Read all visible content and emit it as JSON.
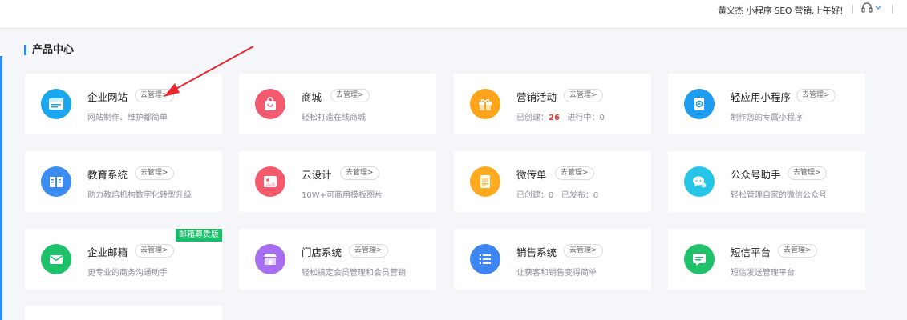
{
  "header": {
    "user_text": "黄义杰  小程序  SEO  营销,上午好!"
  },
  "section": {
    "title": "产品中心"
  },
  "manage_label": "去管理>",
  "cards": [
    {
      "name": "企业网站",
      "desc": "网站制作、维护都简单",
      "icon": "website-icon",
      "color": "#1aa7ee"
    },
    {
      "name": "商城",
      "desc": "轻松打造在线商城",
      "icon": "shopping-bag-icon",
      "color": "#f25a6f"
    },
    {
      "name": "营销活动",
      "desc_prefix": "已创建：",
      "desc_count": "26",
      "desc_suffix": "进行中：0",
      "icon": "gift-icon",
      "color": "#ffa41b"
    },
    {
      "name": "轻应用小程序",
      "desc": "制作您的专属小程序",
      "icon": "mini-program-icon",
      "color": "#1e9cf0"
    },
    {
      "name": "教育系统",
      "desc": "助力教培机构数字化转型升级",
      "icon": "book-icon",
      "color": "#3d8cf2"
    },
    {
      "name": "云设计",
      "desc": "10W+可商用模板图片",
      "icon": "image-icon",
      "color": "#f35a6b"
    },
    {
      "name": "微传单",
      "desc": "已创建：0   已发布：0",
      "icon": "flyer-icon",
      "color": "#ffaa1f"
    },
    {
      "name": "公众号助手",
      "desc": "轻松管理自家的微信公众号",
      "icon": "wechat-icon",
      "color": "#26c4e6"
    },
    {
      "name": "企业邮箱",
      "desc": "更专业的商务沟通助手",
      "icon": "mail-icon",
      "color": "#1fc26a",
      "badge": "邮箱尊贵版"
    },
    {
      "name": "门店系统",
      "desc": "轻松搞定会员管理和会员营销",
      "icon": "store-icon",
      "color": "#a86ef0"
    },
    {
      "name": "销售系统",
      "desc": "让获客和销售变得简单",
      "icon": "list-icon",
      "color": "#3d86f2"
    },
    {
      "name": "短信平台",
      "desc": "短信发送管理平台",
      "icon": "sms-icon",
      "color": "#1fc26a"
    }
  ]
}
